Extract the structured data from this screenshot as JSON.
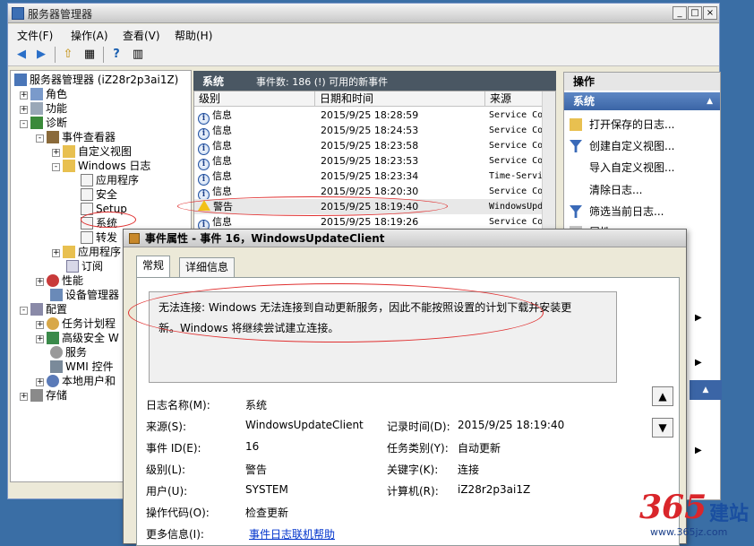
{
  "window": {
    "title": "服务器管理器",
    "controls": {
      "minimize": "_",
      "maximize": "□",
      "close": "×"
    }
  },
  "menubar": [
    "文件(F)",
    "操作(A)",
    "查看(V)",
    "帮助(H)"
  ],
  "tree": [
    {
      "label": "服务器管理器 (iZ28r2p3ai1Z)",
      "indent": 0,
      "toggle": ""
    },
    {
      "label": "角色",
      "indent": 1,
      "toggle": "+"
    },
    {
      "label": "功能",
      "indent": 1,
      "toggle": "+"
    },
    {
      "label": "诊断",
      "indent": 1,
      "toggle": "-"
    },
    {
      "label": "事件查看器",
      "indent": 2,
      "toggle": "-"
    },
    {
      "label": "自定义视图",
      "indent": 3,
      "toggle": "+"
    },
    {
      "label": "Windows 日志",
      "indent": 3,
      "toggle": "-"
    },
    {
      "label": "应用程序",
      "indent": 4,
      "toggle": ""
    },
    {
      "label": "安全",
      "indent": 4,
      "toggle": ""
    },
    {
      "label": "Setup",
      "indent": 4,
      "toggle": ""
    },
    {
      "label": "系统",
      "indent": 4,
      "toggle": ""
    },
    {
      "label": "转发",
      "indent": 4,
      "toggle": ""
    },
    {
      "label": "应用程序",
      "indent": 3,
      "toggle": "+"
    },
    {
      "label": "订阅",
      "indent": 3,
      "toggle": ""
    },
    {
      "label": "性能",
      "indent": 2,
      "toggle": "+"
    },
    {
      "label": "设备管理器",
      "indent": 2,
      "toggle": ""
    },
    {
      "label": "配置",
      "indent": 1,
      "toggle": "-"
    },
    {
      "label": "任务计划程",
      "indent": 2,
      "toggle": "+"
    },
    {
      "label": "高级安全 W",
      "indent": 2,
      "toggle": "+"
    },
    {
      "label": "服务",
      "indent": 2,
      "toggle": ""
    },
    {
      "label": "WMI 控件",
      "indent": 2,
      "toggle": ""
    },
    {
      "label": "本地用户和",
      "indent": 2,
      "toggle": "+"
    },
    {
      "label": "存储",
      "indent": 1,
      "toggle": "+"
    }
  ],
  "center": {
    "title": "系统",
    "event_count": "事件数: 186 (!) 可用的新事件",
    "columns": [
      "级别",
      "日期和时间",
      "来源"
    ],
    "rows": [
      {
        "level": "信息",
        "type": "info",
        "datetime": "2015/9/25 18:28:59",
        "source": "Service Co"
      },
      {
        "level": "信息",
        "type": "info",
        "datetime": "2015/9/25 18:24:53",
        "source": "Service Co"
      },
      {
        "level": "信息",
        "type": "info",
        "datetime": "2015/9/25 18:23:58",
        "source": "Service Co"
      },
      {
        "level": "信息",
        "type": "info",
        "datetime": "2015/9/25 18:23:53",
        "source": "Service Co"
      },
      {
        "level": "信息",
        "type": "info",
        "datetime": "2015/9/25 18:23:34",
        "source": "Time-Servi"
      },
      {
        "level": "信息",
        "type": "info",
        "datetime": "2015/9/25 18:20:30",
        "source": "Service Co"
      },
      {
        "level": "警告",
        "type": "warn",
        "datetime": "2015/9/25 18:19:40",
        "source": "WindowsUpd"
      },
      {
        "level": "信息",
        "type": "info",
        "datetime": "2015/9/25 18:19:26",
        "source": "Service Co"
      }
    ]
  },
  "actions": {
    "header": "操作",
    "section": "系统",
    "items": [
      "打开保存的日志...",
      "创建自定义视图...",
      "导入自定义视图...",
      "清除日志...",
      "筛选当前日志...",
      "属性"
    ]
  },
  "dialog": {
    "title": "事件属性 - 事件 16，WindowsUpdateClient",
    "tabs": [
      "常规",
      "详细信息"
    ],
    "description_line1": "无法连接: Windows 无法连接到自动更新服务，因此不能按照设置的计划下载并安装更",
    "description_line2": "新。Windows 将继续尝试建立连接。",
    "fields": {
      "log_name_label": "日志名称(M):",
      "log_name": "系统",
      "source_label": "来源(S):",
      "source": "WindowsUpdateClient",
      "logged_label": "记录时间(D):",
      "logged": "2015/9/25 18:19:40",
      "event_id_label": "事件 ID(E):",
      "event_id": "16",
      "task_label": "任务类别(Y):",
      "task": "自动更新",
      "level_label": "级别(L):",
      "level": "警告",
      "keywords_label": "关键字(K):",
      "keywords": "连接",
      "user_label": "用户(U):",
      "user": "SYSTEM",
      "computer_label": "计算机(R):",
      "computer": "iZ28r2p3ai1Z",
      "opcode_label": "操作代码(O):",
      "opcode": "检查更新",
      "more_info_label": "更多信息(I):",
      "more_info": "事件日志联机帮助"
    }
  },
  "watermark": {
    "logo": "365",
    "brand": "建站",
    "url": "www.365jz.com"
  }
}
